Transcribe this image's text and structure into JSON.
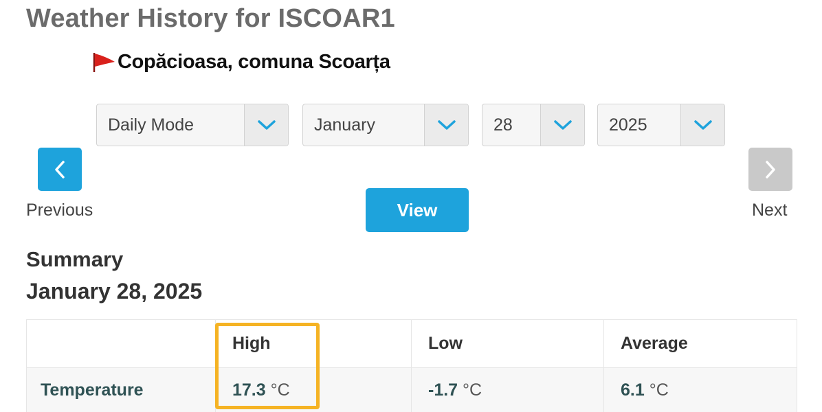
{
  "header": {
    "title": "Weather History for ISCOAR1",
    "station_name": "Copăcioasa, comuna Scoarța",
    "flag_icon": "red-pennant-flag",
    "flag_color": "#d9211c"
  },
  "controls": {
    "mode": "Daily Mode",
    "month": "January",
    "day": "28",
    "year": "2025",
    "arrow_icon": "chevron-down",
    "arrow_color": "#1ea3dc"
  },
  "navigation": {
    "previous_label": "Previous",
    "next_label": "Next",
    "previous_color": "#1ea3dc",
    "next_color": "#c9c9c9",
    "view_label": "View",
    "view_color": "#1ea3dc"
  },
  "summary": {
    "title": "Summary",
    "date": "January 28, 2025",
    "columns": [
      "",
      "High",
      "Low",
      "Average"
    ],
    "rows": [
      {
        "label": "Temperature",
        "high": "17.3",
        "low": "-1.7",
        "average": "6.1",
        "unit": "°C"
      }
    ],
    "highlight_color": "#f5b324"
  }
}
